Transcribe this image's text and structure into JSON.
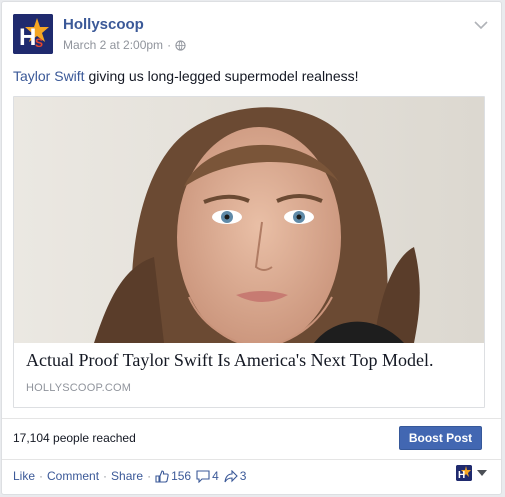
{
  "page": {
    "name": "Hollyscoop",
    "timestamp": "March 2 at 2:00pm",
    "meta_separator": "·",
    "audience_icon": "globe-icon",
    "menu_icon": "chevron-down-icon"
  },
  "post": {
    "mention": "Taylor Swift",
    "text": " giving us long-legged supermodel realness!"
  },
  "link_preview": {
    "title": "Actual Proof Taylor Swift Is America's Next Top Model.",
    "source": "HOLLYSCOOP.COM"
  },
  "insights": {
    "reach_text": "17,104 people reached",
    "boost_label": "Boost Post"
  },
  "actions": {
    "like": "Like",
    "comment": "Comment",
    "share": "Share",
    "separator": "·",
    "likes_count": "156",
    "comments_count": "4",
    "shares_count": "3"
  },
  "colors": {
    "brand_blue": "#3b5998",
    "boost_blue": "#4267b2",
    "meta_gray": "#90949c"
  }
}
